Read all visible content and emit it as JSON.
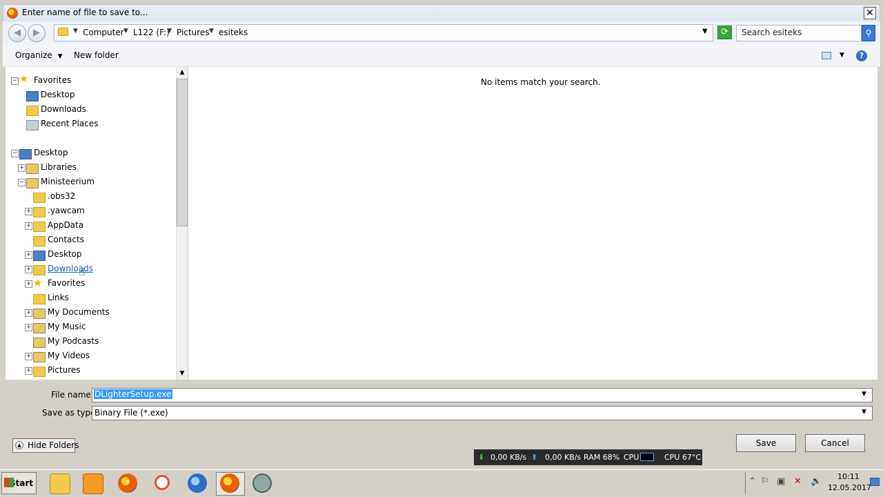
{
  "window": {
    "title": "Enter name of file to save to...",
    "close_glyph": "✕"
  },
  "address": {
    "crumbs": [
      "Computer",
      "L122 (F:)",
      "Pictures",
      "esiteks"
    ],
    "search_placeholder": "Search esiteks"
  },
  "toolbar": {
    "organize": "Organize",
    "new_folder": "New folder",
    "help": "?"
  },
  "tree": {
    "favorites": {
      "label": "Favorites",
      "items": [
        "Desktop",
        "Downloads",
        "Recent Places"
      ]
    },
    "desktop": {
      "label": "Desktop",
      "items": [
        "Libraries",
        "Ministeerium"
      ],
      "sub_items": [
        ".obs32",
        ".yawcam",
        "AppData",
        "Contacts",
        "Desktop",
        "Downloads",
        "Favorites",
        "Links",
        "My Documents",
        "My Music",
        "My Podcasts",
        "My Videos",
        "Pictures"
      ]
    }
  },
  "content": {
    "empty_message": "No items match your search."
  },
  "form": {
    "filename_label": "File name:",
    "filename_value": "DLighterSetup.exe",
    "savetype_label": "Save as type:",
    "savetype_value": "Binary File (*.exe)"
  },
  "buttons": {
    "hide_folders": "Hide Folders",
    "save": "Save",
    "cancel": "Cancel"
  },
  "monitor": {
    "down": "0,00 KB/s",
    "up": "0,00 KB/s",
    "ram": "RAM 68%",
    "cpu": "CPU",
    "cpu_temp": "CPU 67°C"
  },
  "taskbar": {
    "start": "Start",
    "time": "10:11",
    "date": "12.05.2017"
  },
  "colors": {
    "accent": "#3399ff",
    "selection": "#3399ff",
    "monitor_bg": "#2b2b2b"
  }
}
